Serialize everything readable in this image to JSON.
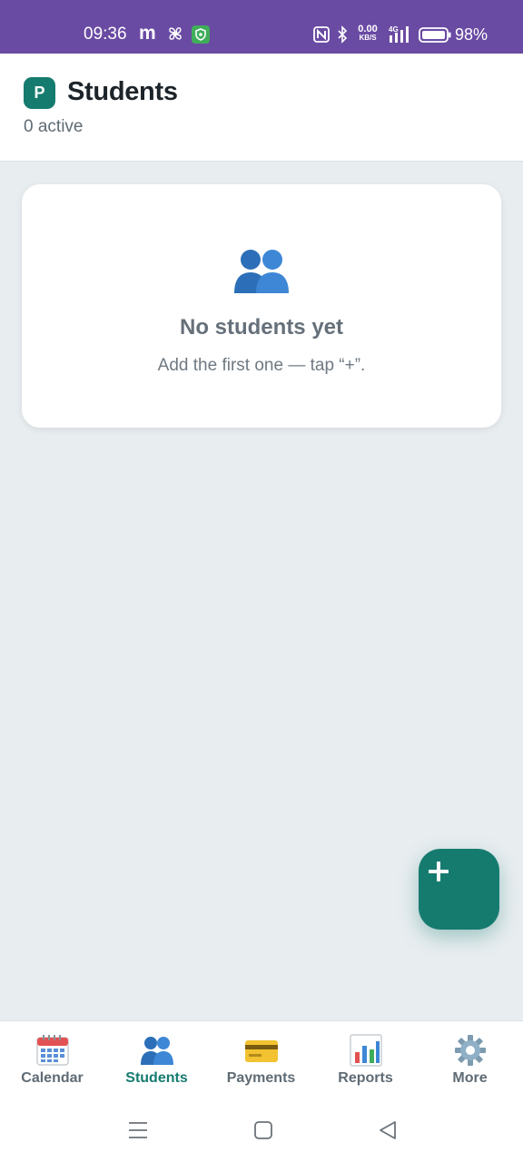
{
  "status_bar": {
    "time": "09:36",
    "carrier_glyph": "m",
    "net_speed_value": "0.00",
    "net_speed_unit": "KB/S",
    "network_type": "4G",
    "battery": "98%",
    "background_color": "#6a4ba3"
  },
  "header": {
    "app_badge": "P",
    "title": "Students",
    "subtitle": "0 active"
  },
  "empty_state": {
    "icon": "people-icon",
    "title": "No students yet",
    "text": "Add the first one — tap “+”."
  },
  "fab": {
    "icon": "plus-icon",
    "color": "#167b6f"
  },
  "bottom_nav": {
    "items": [
      {
        "label": "Calendar",
        "icon": "calendar-icon",
        "active": false
      },
      {
        "label": "Students",
        "icon": "people-icon",
        "active": true
      },
      {
        "label": "Payments",
        "icon": "credit-card-icon",
        "active": false
      },
      {
        "label": "Reports",
        "icon": "bar-chart-icon",
        "active": false
      },
      {
        "label": "More",
        "icon": "gear-icon",
        "active": false
      }
    ],
    "active_color": "#167b6f"
  },
  "system_nav": {
    "buttons": [
      "menu-icon",
      "home-icon",
      "back-icon"
    ]
  }
}
